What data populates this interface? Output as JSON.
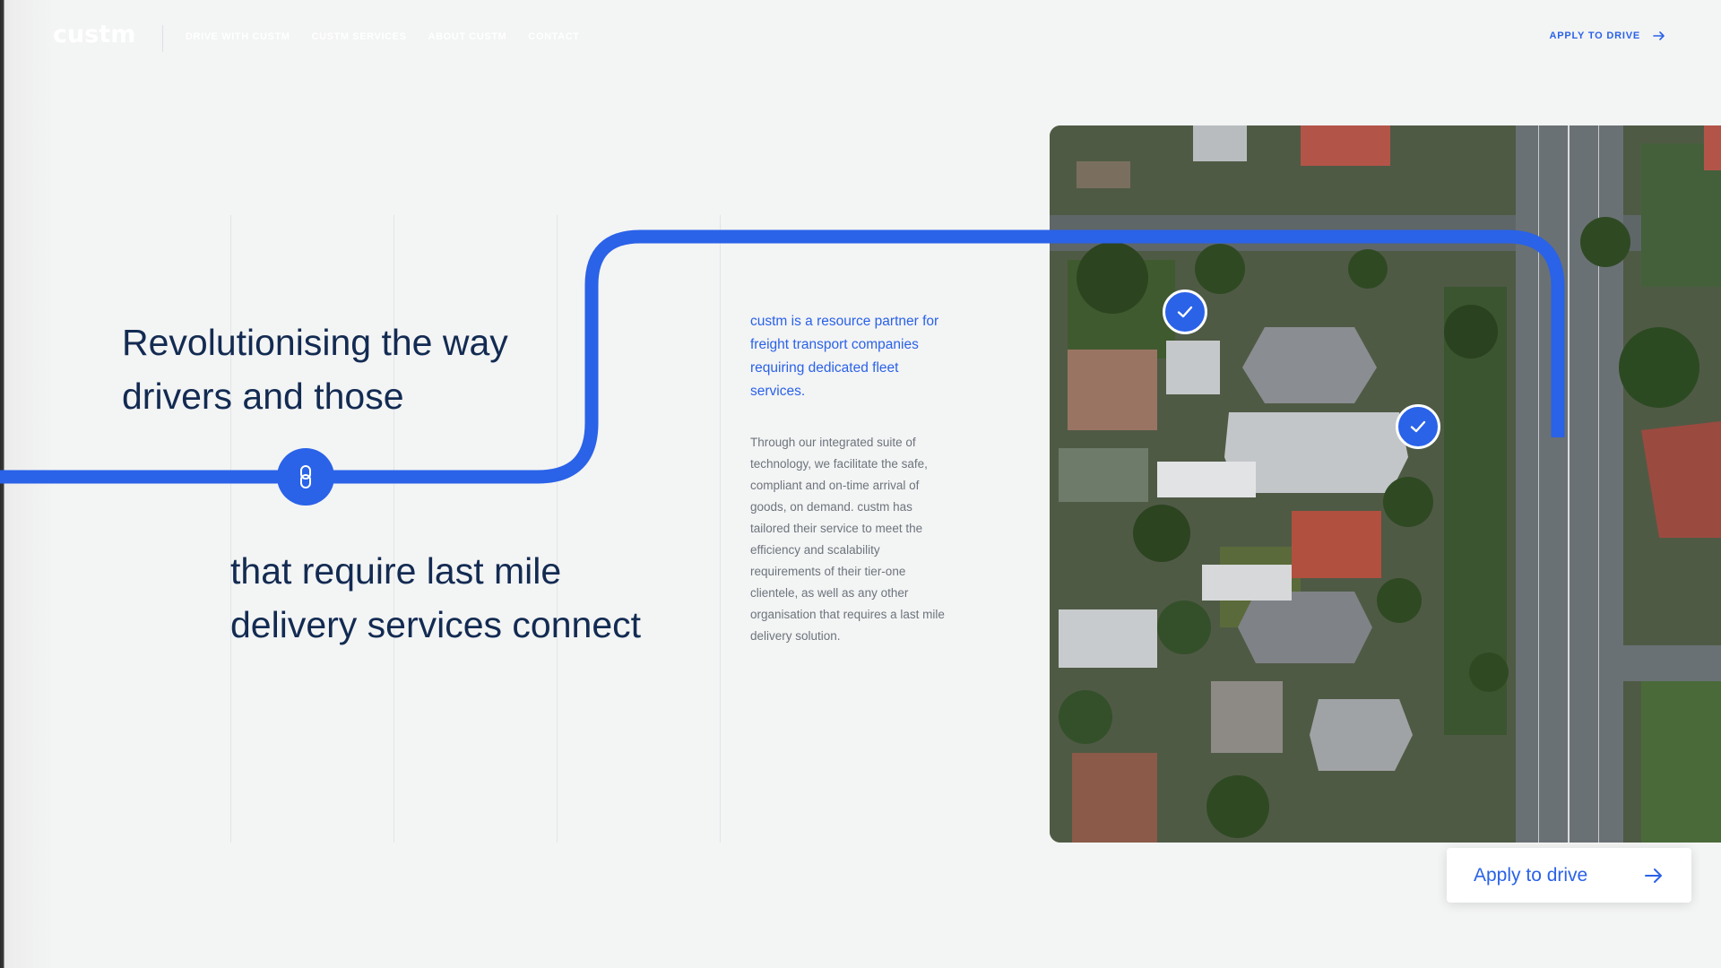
{
  "brand": {
    "logo": "custm",
    "accent": "#2a62e8",
    "heading_color": "#132b52"
  },
  "nav": {
    "links": [
      "DRIVE WITH CUSTM",
      "CUSTM SERVICES",
      "ABOUT CUSTM",
      "CONTACT"
    ],
    "cta": "APPLY TO DRIVE"
  },
  "hero": {
    "line1": "Revolutionising the way",
    "line2": "drivers and those",
    "line3": "that require last mile",
    "line4": "delivery services connect"
  },
  "intro": {
    "lead": "custm is a resource partner for freight transport companies requiring dedicated fleet services.",
    "body": "Through our integrated suite of technology, we facilitate the safe, compliant and on-time arrival of goods, on demand. custm has tailored their service to meet the efficiency and scalability requirements of their tier-one clientele, as well as any other organisation that requires a last mile delivery solution."
  },
  "card": {
    "label": "Apply to drive"
  },
  "icons": {
    "link": "link-icon",
    "check": "check-icon",
    "arrow": "arrow-right-icon"
  }
}
